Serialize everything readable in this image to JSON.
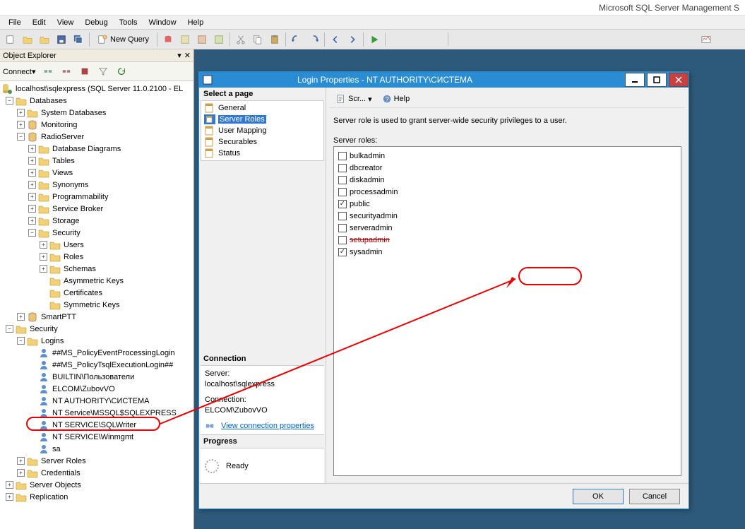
{
  "app_title": "Microsoft SQL Server Management S",
  "menu": [
    "File",
    "Edit",
    "View",
    "Debug",
    "Tools",
    "Window",
    "Help"
  ],
  "toolbar": {
    "new_query": "New Query"
  },
  "object_explorer": {
    "title": "Object Explorer",
    "connect": "Connect",
    "root": "localhost\\sqlexpress (SQL Server 11.0.2100 - EL",
    "databases": "Databases",
    "sys_databases": "System Databases",
    "monitoring": "Monitoring",
    "radioserver": "RadioServer",
    "rs": {
      "diagrams": "Database Diagrams",
      "tables": "Tables",
      "views": "Views",
      "synonyms": "Synonyms",
      "programmability": "Programmability",
      "service_broker": "Service Broker",
      "storage": "Storage",
      "security": "Security",
      "users": "Users",
      "roles": "Roles",
      "schemas": "Schemas",
      "asym": "Asymmetric Keys",
      "certs": "Certificates",
      "sym": "Symmetric Keys"
    },
    "smartptt": "SmartPTT",
    "security": "Security",
    "logins": "Logins",
    "login_list": [
      "##MS_PolicyEventProcessingLogin",
      "##MS_PolicyTsqlExecutionLogin##",
      "BUILTIN\\Пользователи",
      "ELCOM\\ZubovVO",
      "NT AUTHORITY\\СИСТЕМА",
      "NT Service\\MSSQL$SQLEXPRESS",
      "NT SERVICE\\SQLWriter",
      "NT SERVICE\\Winmgmt",
      "sa"
    ],
    "server_roles": "Server Roles",
    "credentials": "Credentials",
    "server_objects": "Server Objects",
    "replication": "Replication"
  },
  "dialog": {
    "title": "Login Properties - NT AUTHORITY\\СИСТЕМА",
    "select_page": "Select a page",
    "pages": [
      "General",
      "Server Roles",
      "User Mapping",
      "Securables",
      "Status"
    ],
    "script": "Scr...",
    "help": "Help",
    "desc": "Server role is used to grant server-wide security privileges to a user.",
    "roles_label": "Server roles:",
    "roles": [
      {
        "name": "bulkadmin",
        "checked": false
      },
      {
        "name": "dbcreator",
        "checked": false
      },
      {
        "name": "diskadmin",
        "checked": false
      },
      {
        "name": "processadmin",
        "checked": false
      },
      {
        "name": "public",
        "checked": true
      },
      {
        "name": "securityadmin",
        "checked": false
      },
      {
        "name": "serveradmin",
        "checked": false
      },
      {
        "name": "setupadmin",
        "checked": false
      },
      {
        "name": "sysadmin",
        "checked": true
      }
    ],
    "connection": "Connection",
    "server_label": "Server:",
    "server_value": "localhost\\sqlexpress",
    "conn_label": "Connection:",
    "conn_value": "ELCOM\\ZubovVO",
    "view_props": "View connection properties",
    "progress": "Progress",
    "ready": "Ready",
    "ok": "OK",
    "cancel": "Cancel"
  }
}
